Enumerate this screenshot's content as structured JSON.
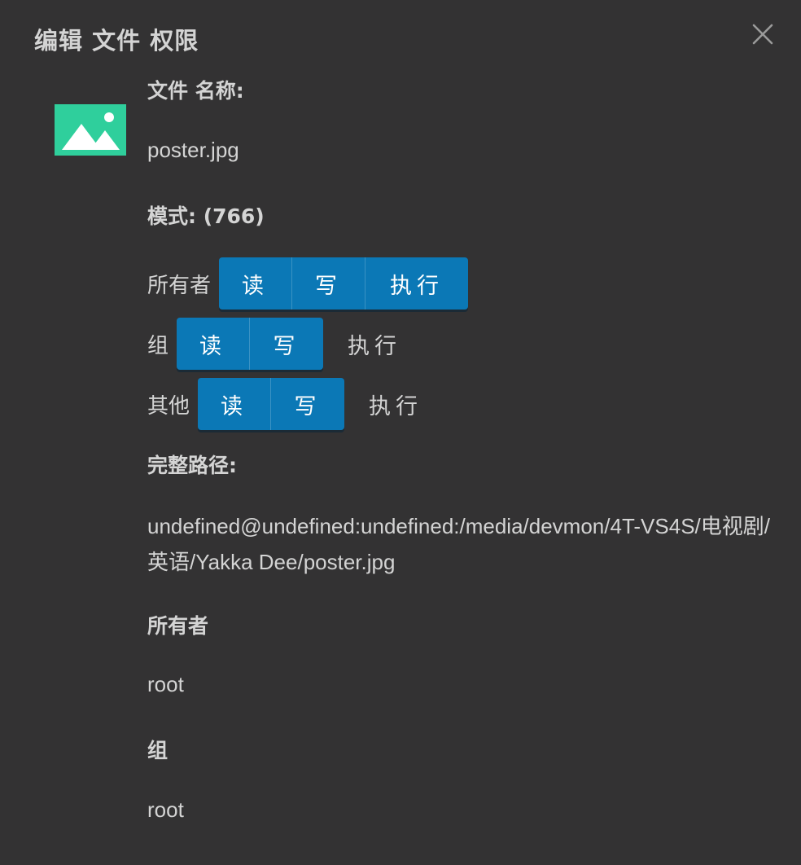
{
  "dialog": {
    "title": "编辑 文件 权限",
    "close_icon": "close-icon",
    "file_icon": "image-file-icon",
    "accent_color": "#0b78b6",
    "icon_color": "#2fcf9c"
  },
  "file_name": {
    "label": "文件 名称:",
    "value": "poster.jpg"
  },
  "mode": {
    "label": "模式: (766)"
  },
  "permissions": {
    "owner": {
      "label": "所有者",
      "read": "读",
      "write": "写",
      "execute": "执行",
      "read_on": true,
      "write_on": true,
      "execute_on": true
    },
    "group": {
      "label": "组",
      "read": "读",
      "write": "写",
      "execute": "执行",
      "read_on": true,
      "write_on": true,
      "execute_on": false
    },
    "other": {
      "label": "其他",
      "read": "读",
      "write": "写",
      "execute": "执行",
      "read_on": true,
      "write_on": true,
      "execute_on": false
    }
  },
  "full_path": {
    "label": "完整路径:",
    "value": "undefined@undefined:undefined:/media/devmon/4T-VS4S/电视剧/英语/Yakka Dee/poster.jpg"
  },
  "owner": {
    "label": "所有者",
    "value": "root"
  },
  "group": {
    "label": "组",
    "value": "root"
  }
}
